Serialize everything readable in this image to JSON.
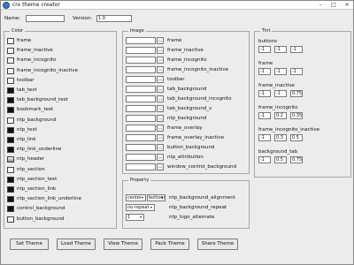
{
  "window": {
    "title": "crx theme creator",
    "minimize": "–",
    "maximize": "□",
    "close": "×"
  },
  "top": {
    "name_label": "Name:",
    "name_value": "",
    "version_label": "Version:",
    "version_value": "1.0"
  },
  "colors": {
    "group_label": "Color",
    "items": [
      {
        "label": "frame",
        "swatch": "light"
      },
      {
        "label": "frame_inactive",
        "swatch": "light"
      },
      {
        "label": "frame_incognito",
        "swatch": "light"
      },
      {
        "label": "frame_incognito_inactive",
        "swatch": "light"
      },
      {
        "label": "toolbar",
        "swatch": "light"
      },
      {
        "label": "tab_text",
        "swatch": "dark"
      },
      {
        "label": "tab_background_text",
        "swatch": "dark"
      },
      {
        "label": "bookmark_text",
        "swatch": "dark"
      },
      {
        "label": "ntp_background",
        "swatch": "light"
      },
      {
        "label": "ntp_text",
        "swatch": "dark"
      },
      {
        "label": "ntp_link",
        "swatch": "dark"
      },
      {
        "label": "ntp_link_underline",
        "swatch": "dark"
      },
      {
        "label": "ntp_header",
        "swatch": "grad"
      },
      {
        "label": "ntp_section",
        "swatch": "light"
      },
      {
        "label": "ntp_section_text",
        "swatch": "dark"
      },
      {
        "label": "ntp_section_link",
        "swatch": "dark"
      },
      {
        "label": "ntp_section_link_underline",
        "swatch": "dark"
      },
      {
        "label": "control_background",
        "swatch": "dark"
      },
      {
        "label": "button_background",
        "swatch": "light"
      }
    ]
  },
  "images": {
    "group_label": "Image",
    "browse_label": "...",
    "items": [
      "frame",
      "frame_inactive",
      "frame_incognito",
      "frame_incognito_inactive",
      "toolbar",
      "tab_background",
      "tab_background_incognito",
      "tab_background_v",
      "ntp_background",
      "frame_overlay",
      "frame_overlay_inactive",
      "button_background",
      "ntp_attribution",
      "window_control_background"
    ]
  },
  "properties": {
    "group_label": "Property",
    "rows": [
      {
        "sel1": "center",
        "sel2": "bottom",
        "label": "ntp_background_alignment"
      },
      {
        "sel1": "no-repeat",
        "label": "ntp_background_repeat"
      },
      {
        "sel1": "1",
        "label": "ntp_logo_alternate"
      }
    ]
  },
  "tints": {
    "group_label": "Tint",
    "items": [
      {
        "label": "buttons",
        "values": [
          "-1",
          "-1",
          "-1"
        ]
      },
      {
        "label": "frame",
        "values": [
          "-1",
          "-1",
          "-1"
        ]
      },
      {
        "label": "frame_inactive",
        "values": [
          "-1",
          "-1",
          "0.75"
        ]
      },
      {
        "label": "frame_incognito",
        "values": [
          "-1",
          "0.2",
          "0.35"
        ]
      },
      {
        "label": "frame_incognito_inactive",
        "values": [
          "-1",
          "0.3",
          "0.5"
        ]
      },
      {
        "label": "background_tab",
        "values": [
          "-1",
          "0.5",
          "0.75"
        ]
      }
    ]
  },
  "buttons": {
    "set_theme": "Set Theme",
    "load_theme": "Load Theme",
    "view_theme": "View Theme",
    "pack_theme": "Pack Theme",
    "share_theme": "Share Theme"
  }
}
